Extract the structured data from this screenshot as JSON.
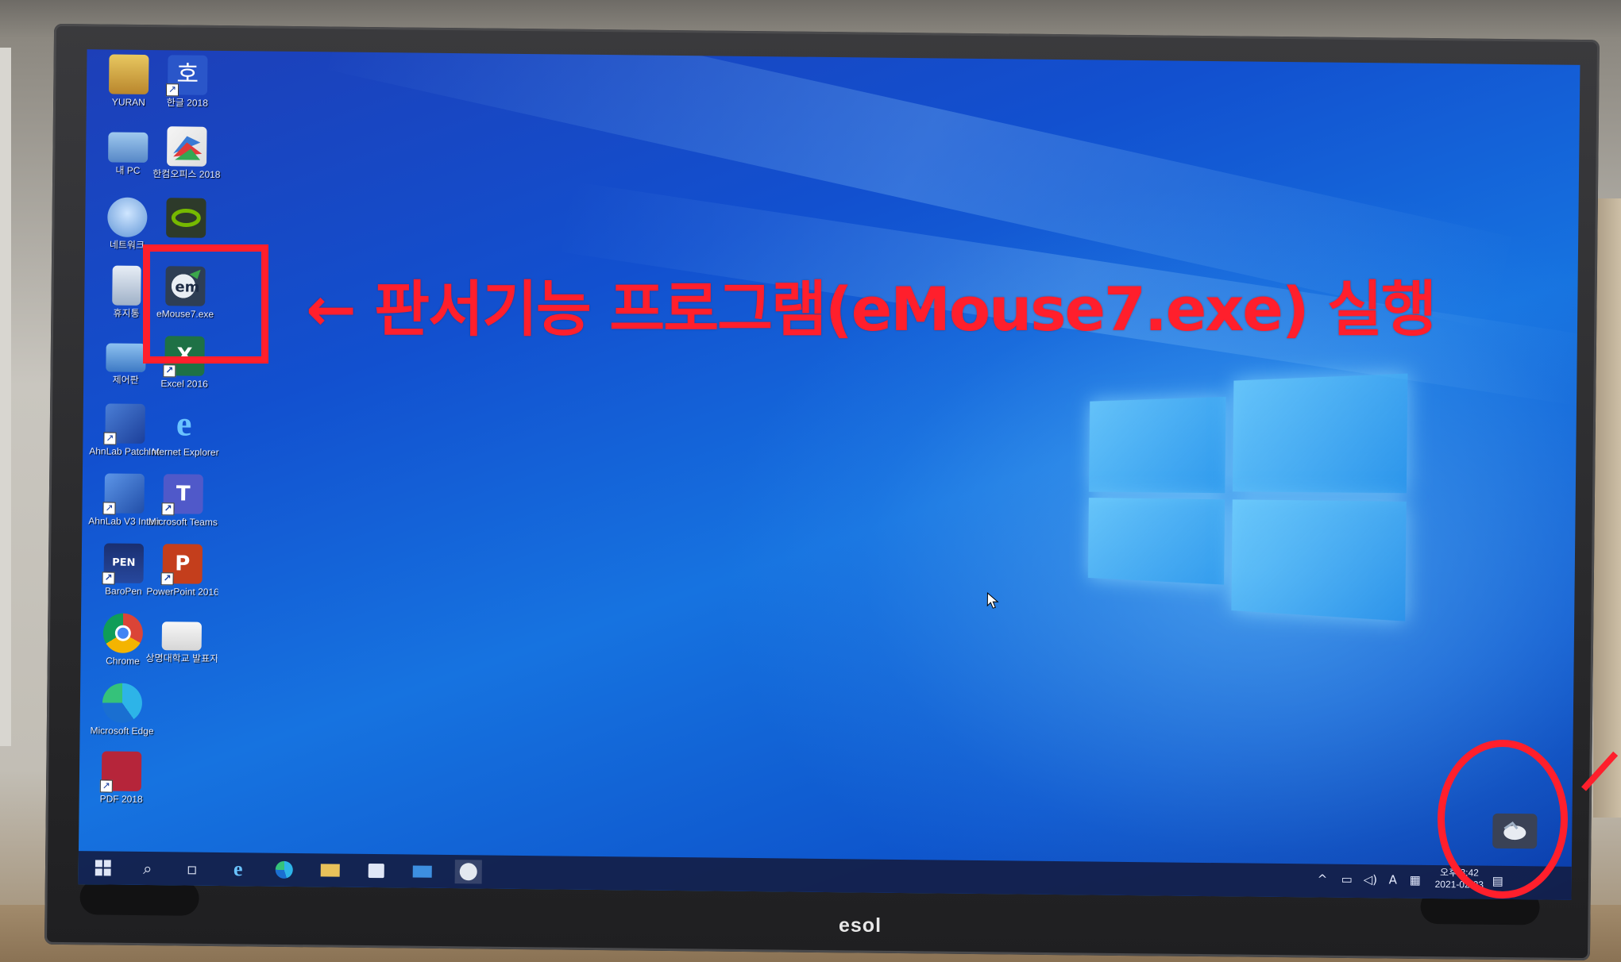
{
  "annotation": {
    "arrow": "←",
    "text": "판서기능 프로그램(eMouse7.exe) 실행",
    "color": "#ff1f2c"
  },
  "brand": "esol",
  "desktop": {
    "icons": [
      {
        "label": "YURAN",
        "icon": "user-folder-icon"
      },
      {
        "label": "한글 2018",
        "icon": "hangul-icon"
      },
      {
        "label": "내 PC",
        "icon": "this-pc-icon"
      },
      {
        "label": "한컴오피스 2018",
        "icon": "hancom-office-icon"
      },
      {
        "label": "네트워크",
        "icon": "network-icon"
      },
      {
        "label": "",
        "icon": "nvidia-icon"
      },
      {
        "label": "휴지통",
        "icon": "recycle-bin-icon"
      },
      {
        "label": "eMouse7.exe",
        "icon": "emouse-icon"
      },
      {
        "label": "제어판",
        "icon": "control-panel-icon"
      },
      {
        "label": "Excel 2016",
        "icon": "excel-icon"
      },
      {
        "label": "AhnLab Patch Man...",
        "icon": "ahnlab-patch-icon"
      },
      {
        "label": "Internet Explorer",
        "icon": "internet-explorer-icon"
      },
      {
        "label": "AhnLab V3 Internet S...",
        "icon": "ahnlab-v3-icon"
      },
      {
        "label": "Microsoft Teams",
        "icon": "teams-icon"
      },
      {
        "label": "BaroPen",
        "icon": "baropen-icon"
      },
      {
        "label": "PowerPoint 2016",
        "icon": "powerpoint-icon"
      },
      {
        "label": "Chrome",
        "icon": "chrome-icon"
      },
      {
        "label": "상명대학교 발표자료...",
        "icon": "presentation-file-icon"
      },
      {
        "label": "Microsoft Edge",
        "icon": "edge-icon"
      },
      {
        "label": "PDF 2018",
        "icon": "pdf-icon"
      }
    ]
  },
  "taskbar": {
    "start": "start-icon",
    "items": [
      "search-icon",
      "task-view-icon",
      "internet-explorer-icon",
      "edge-icon",
      "file-explorer-icon",
      "store-icon",
      "mail-icon",
      "emouse-icon"
    ],
    "tray": {
      "chevron": "^",
      "ime": "A",
      "time": "오후 3:42",
      "date": "2021-02-23"
    }
  }
}
